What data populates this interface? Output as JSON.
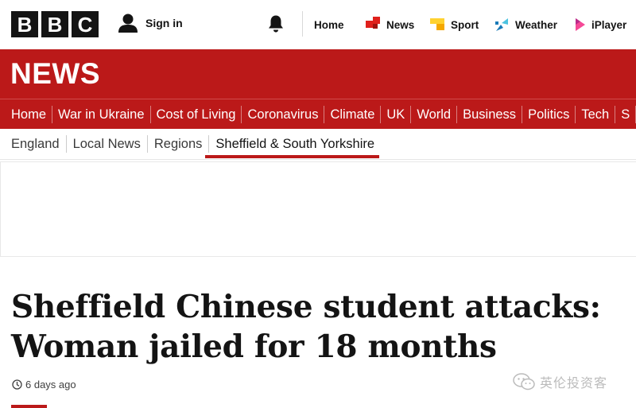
{
  "brand": {
    "letters": [
      "B",
      "B",
      "C"
    ]
  },
  "account": {
    "signin_label": "Sign in"
  },
  "top_nav": [
    {
      "label": "Home",
      "icon": "none",
      "color": ""
    },
    {
      "label": "News",
      "icon": "news-icon",
      "color": "#e0201b"
    },
    {
      "label": "Sport",
      "icon": "sport-icon",
      "color": "#ffd230"
    },
    {
      "label": "Weather",
      "icon": "weather-icon",
      "color": "#1a7ab8"
    },
    {
      "label": "iPlayer",
      "icon": "iplayer-icon",
      "color": "#f54997"
    }
  ],
  "section": {
    "title": "NEWS",
    "color": "#bb1919"
  },
  "primary_nav": [
    "Home",
    "War in Ukraine",
    "Cost of Living",
    "Coronavirus",
    "Climate",
    "UK",
    "World",
    "Business",
    "Politics",
    "Tech",
    "S"
  ],
  "secondary_nav": [
    "England",
    "Local News",
    "Regions",
    "Sheffield & South Yorkshire"
  ],
  "secondary_active": "Sheffield & South Yorkshire",
  "article": {
    "headline_line1": "Sheffield Chinese student attacks:",
    "headline_line2": "Woman jailed for 18 months",
    "timestamp": "6 days ago"
  },
  "watermark": {
    "text": "英伦投资客"
  }
}
